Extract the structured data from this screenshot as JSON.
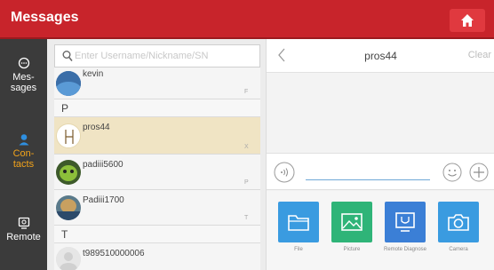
{
  "app": {
    "title": "Messages"
  },
  "nav": {
    "items": [
      {
        "label_line1": "Mes-",
        "label_line2": "sages",
        "icon": "chat-bubble-icon"
      },
      {
        "label_line1": "Con-",
        "label_line2": "tacts",
        "icon": "person-icon",
        "active": true
      },
      {
        "label_line1": "Remote",
        "label_line2": "",
        "icon": "remote-icon"
      }
    ]
  },
  "search": {
    "placeholder": "Enter Username/Nickname/SN"
  },
  "contacts": {
    "first_row": {
      "name": "kevin",
      "letter": "F"
    },
    "section_p": "P",
    "rows": [
      {
        "name": "pros44",
        "letter": "X"
      },
      {
        "name": "padiii5600",
        "letter": "P"
      },
      {
        "name": "Padiii1700",
        "letter": "T"
      }
    ],
    "section_t": "T",
    "last_row": {
      "name": "t989510000006"
    }
  },
  "chat": {
    "title": "pros44",
    "clear_label": "Clear",
    "tools": [
      {
        "label": "File",
        "color": "#3a9be0"
      },
      {
        "label": "Picture",
        "color": "#2fb478"
      },
      {
        "label": "Remote Diagnose",
        "color": "#3b7fd6"
      },
      {
        "label": "Camera",
        "color": "#3a9be0"
      }
    ]
  },
  "colors": {
    "topbar": "#c8242b",
    "nav": "#3b3b3b",
    "active": "#f2a31b",
    "selected_row": "#f0e4c4"
  }
}
